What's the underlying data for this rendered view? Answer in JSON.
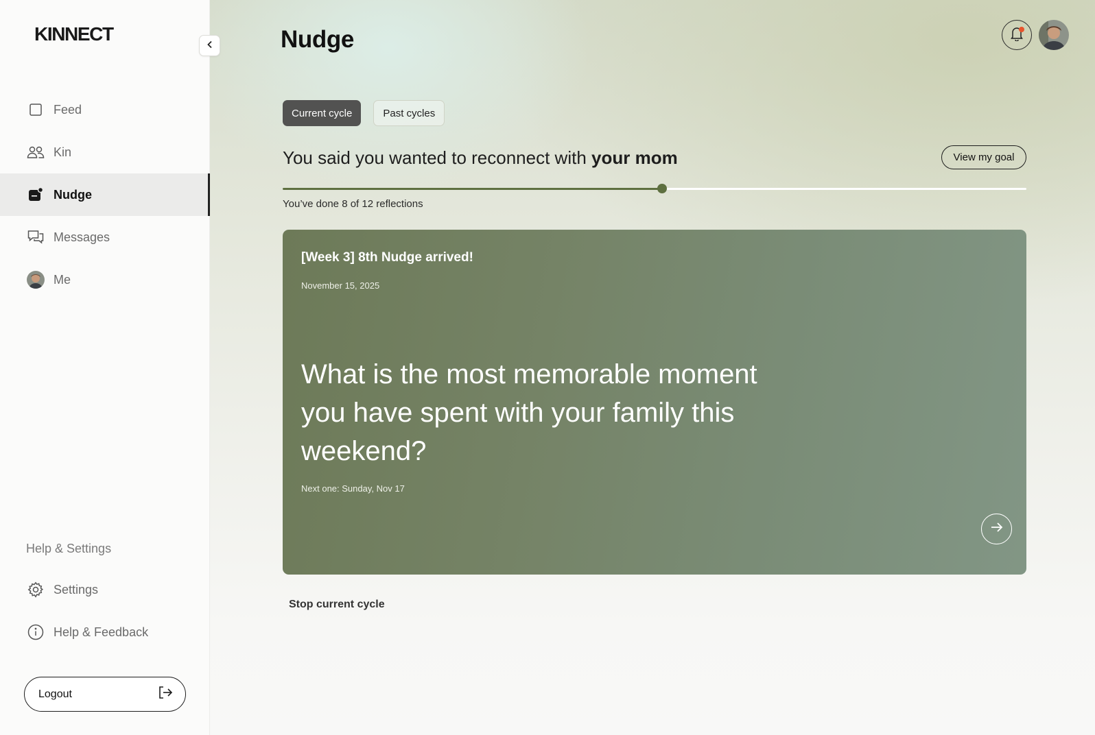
{
  "sidebar": {
    "logo": "KINNECT",
    "nav": [
      {
        "label": "Feed",
        "icon": "square-icon"
      },
      {
        "label": "Kin",
        "icon": "people-icon"
      },
      {
        "label": "Nudge",
        "icon": "nudge-icon",
        "active": true
      },
      {
        "label": "Messages",
        "icon": "chat-icon"
      },
      {
        "label": "Me",
        "icon": "avatar"
      }
    ],
    "help_heading": "Help & Settings",
    "bottom": [
      {
        "label": "Settings",
        "icon": "gear-icon"
      },
      {
        "label": "Help & Feedback",
        "icon": "info-icon"
      }
    ],
    "logout_label": "Logout"
  },
  "header": {
    "title": "Nudge",
    "has_notification": true
  },
  "tabs": [
    "Current cycle",
    "Past cycles"
  ],
  "goal": {
    "prefix": "You said you wanted to reconnect with",
    "target": "your mom",
    "view_label": "View my goal",
    "done": 8,
    "total": 12,
    "progress_label": "You’ve done 8 of 12 reflections"
  },
  "card": {
    "title": "[Week 3] 8th Nudge arrived!",
    "date": "November 15, 2025",
    "question": "What is the most memorable moment you have spent with your family this weekend?",
    "next": "Next one: Sunday, Nov 17"
  },
  "stop_label": "Stop current cycle",
  "colors": {
    "accent": "#5e7040",
    "card_start": "#6d7a58",
    "card_end": "#829685",
    "notification_dot": "#e8542c"
  }
}
